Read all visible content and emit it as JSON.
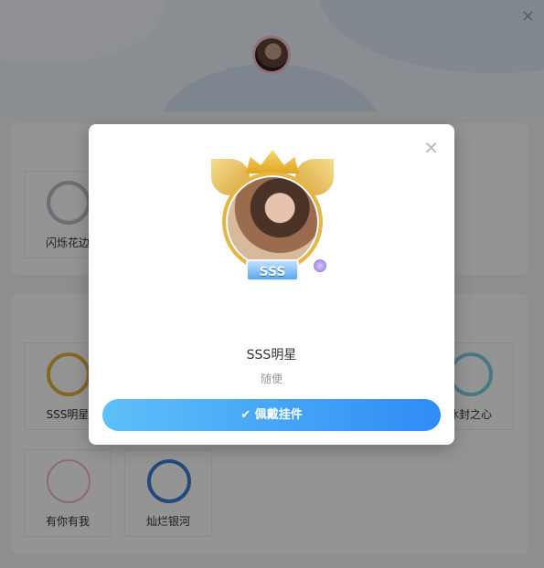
{
  "header": {
    "close_glyph": "✕",
    "avatar_icon": "user-avatar"
  },
  "frames": [
    {
      "label": "闪烁花边",
      "style": "silver"
    },
    {
      "label": "SSS明星",
      "style": "gold"
    },
    {
      "label": "冰封之心",
      "style": "ice"
    },
    {
      "label": "有你有我",
      "style": "pink"
    },
    {
      "label": "灿烂银河",
      "style": "blue"
    }
  ],
  "modal": {
    "close_glyph": "✕",
    "badge_text": "SSS",
    "name": "SSS明星",
    "desc": "随便",
    "button_icon": "check-icon",
    "button_label": "✔ 佩戴挂件"
  },
  "colors": {
    "button_start": "#5ec0f8",
    "button_end": "#2f8cf6",
    "overlay": "rgba(0,0,0,0.42)"
  }
}
